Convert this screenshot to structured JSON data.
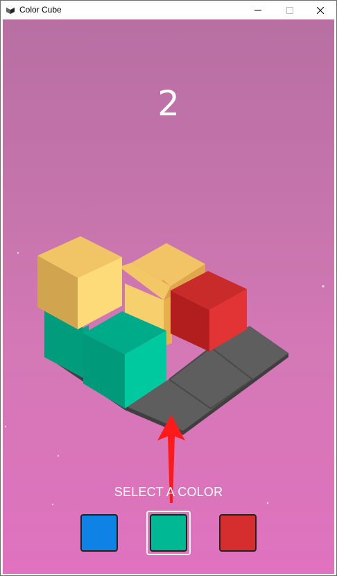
{
  "window": {
    "title": "Color Cube"
  },
  "game": {
    "score": "2",
    "prompt": "SELECT A COLOR",
    "palette": [
      {
        "name": "blue",
        "color": "#0f82e6"
      },
      {
        "name": "green",
        "color": "#00b894",
        "selected": true
      },
      {
        "name": "red",
        "color": "#d62e2e"
      }
    ]
  },
  "colors": {
    "background_top": "#b86fa2",
    "background_bottom": "#e072bf",
    "board": "#5c5c5c",
    "yellow": "#f7d06e",
    "green": "#00b894",
    "red": "#d83232",
    "arrow": "#ff1a1a"
  }
}
